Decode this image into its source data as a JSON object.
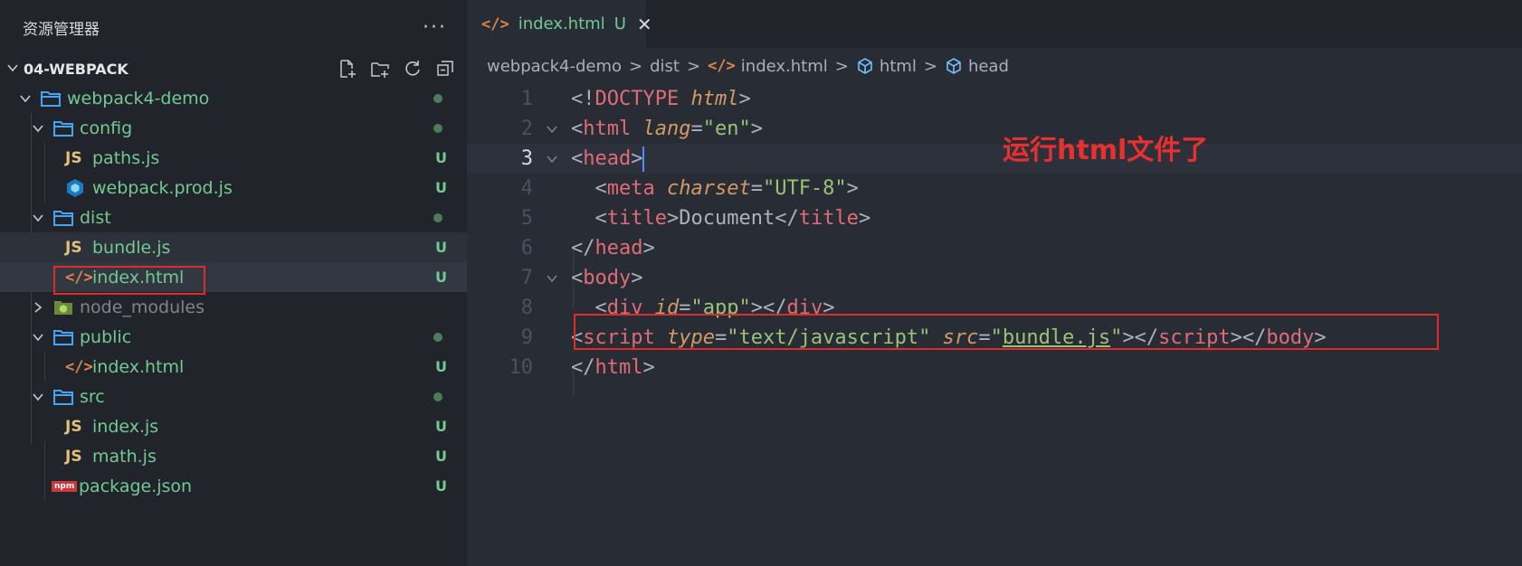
{
  "sidebar": {
    "title": "资源管理器",
    "more_label": "···",
    "section": "04-WEBPACK",
    "tree": [
      {
        "name": "webpack4-demo",
        "type": "folder",
        "status": "dot"
      },
      {
        "name": "config",
        "type": "folder",
        "status": "dot"
      },
      {
        "name": "paths.js",
        "type": "js",
        "status": "U"
      },
      {
        "name": "webpack.prod.js",
        "type": "webpack",
        "status": "U"
      },
      {
        "name": "dist",
        "type": "folder",
        "status": "dot"
      },
      {
        "name": "bundle.js",
        "type": "js",
        "status": "U"
      },
      {
        "name": "index.html",
        "type": "html",
        "status": "U"
      },
      {
        "name": "node_modules",
        "type": "node",
        "status": ""
      },
      {
        "name": "public",
        "type": "folder",
        "status": "dot"
      },
      {
        "name": "index.html",
        "type": "html",
        "status": "U"
      },
      {
        "name": "src",
        "type": "folder",
        "status": "dot"
      },
      {
        "name": "index.js",
        "type": "js",
        "status": "U"
      },
      {
        "name": "math.js",
        "type": "js",
        "status": "U"
      },
      {
        "name": "package.json",
        "type": "npm",
        "status": "U"
      }
    ],
    "icon_labels": {
      "js": "JS",
      "html": "</>",
      "npm": "npm"
    },
    "status_label": "U"
  },
  "tab": {
    "label": "index.html",
    "status": "U",
    "close": "✕",
    "icon": "</>"
  },
  "breadcrumb": {
    "items": [
      "webpack4-demo",
      "dist",
      "index.html",
      "html",
      "head"
    ],
    "separator": ">"
  },
  "code": {
    "line_numbers": [
      "1",
      "2",
      "3",
      "4",
      "5",
      "6",
      "7",
      "8",
      "9",
      "10"
    ],
    "current_line": "3"
  },
  "annotation": "运行html文件了",
  "colors": {
    "highlight_box": "#e02b2b",
    "annotation": "#e8302f",
    "untracked": "#73c991"
  }
}
